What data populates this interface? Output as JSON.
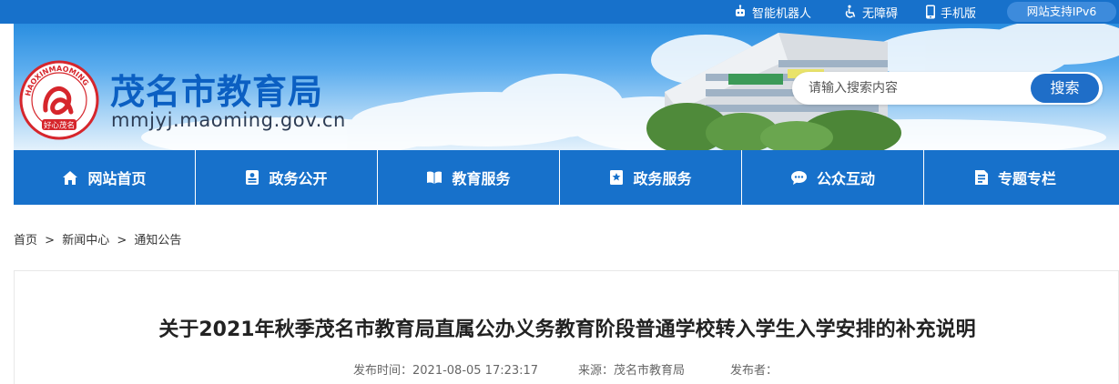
{
  "topbar": {
    "robot_label": "智能机器人",
    "accessibility_label": "无障碍",
    "mobile_label": "手机版",
    "ipv6_label": "网站支持IPv6"
  },
  "header": {
    "site_title": "茂名市教育局",
    "site_url": "mmjyj.maoming.gov.cn",
    "logo_ring_text": "HAOXINMAOMING",
    "logo_caption": "好心茂名",
    "search_placeholder": "请输入搜索内容",
    "search_button": "搜索"
  },
  "nav": {
    "items": [
      {
        "label": "网站首页",
        "icon": "home-icon"
      },
      {
        "label": "政务公开",
        "icon": "id-card-icon"
      },
      {
        "label": "教育服务",
        "icon": "book-icon"
      },
      {
        "label": "政务服务",
        "icon": "star-bookmark-icon"
      },
      {
        "label": "公众互动",
        "icon": "chat-icon"
      },
      {
        "label": "专题专栏",
        "icon": "document-icon"
      }
    ]
  },
  "breadcrumb": {
    "home": "首页",
    "news": "新闻中心",
    "notices": "通知公告",
    "separator": ">"
  },
  "article": {
    "title": "关于2021年秋季茂名市教育局直属公办义务教育阶段普通学校转入学生入学安排的补充说明",
    "publish_time": "发布时间：2021-08-05 17:23:17",
    "source": "来源：茂名市教育局",
    "publisher": "发布者："
  },
  "colors": {
    "primary_blue": "#1771cb",
    "title_blue": "#0b5fc2",
    "logo_red": "#d6262c"
  }
}
